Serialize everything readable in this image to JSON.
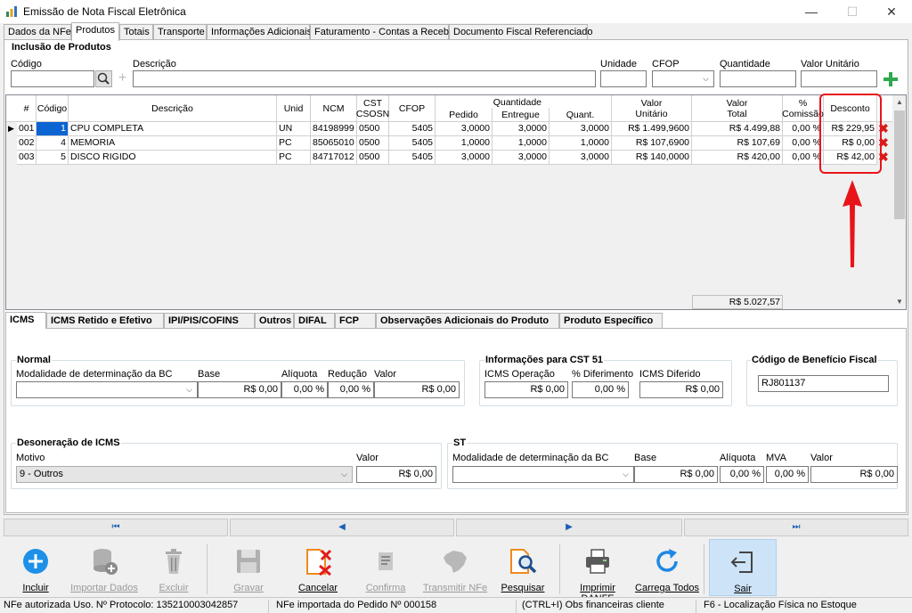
{
  "window": {
    "title": "Emissão de Nota Fiscal Eletrônica",
    "minimize": "—",
    "maximize": "☐",
    "close": "✕"
  },
  "tabs": [
    "Dados da NFe",
    "Produtos",
    "Totais",
    "Transporte",
    "Informações Adicionais",
    "Faturamento - Contas a Receber",
    "Documento Fiscal Referenciado"
  ],
  "inclusao": {
    "title": "Inclusão de Produtos",
    "labels": {
      "codigo": "Código",
      "descricao": "Descrição",
      "unidade": "Unidade",
      "cfop": "CFOP",
      "quantidade": "Quantidade",
      "valor_unitario": "Valor Unitário"
    },
    "values": {
      "codigo": "",
      "descricao": "",
      "unidade": "",
      "cfop": "",
      "quantidade": "",
      "valor_unitario": ""
    }
  },
  "grid": {
    "headers": {
      "num": "#",
      "codigo": "Código",
      "descricao": "Descrição",
      "unid": "Unid",
      "ncm": "NCM",
      "cst": "CST CSOSN",
      "cfop": "CFOP",
      "qtd_group": "Quantidade",
      "pedido": "Pedido",
      "entregue": "Entregue",
      "quant": "Quant.",
      "valor_unit": "Valor Unitário",
      "valor_total": "Valor Total",
      "comissao": "% Comissão",
      "desconto": "Desconto"
    },
    "rows": [
      {
        "num": "001",
        "codigo": "1",
        "descricao": "CPU COMPLETA",
        "unid": "UN",
        "ncm": "84198999",
        "cst": "0500",
        "cfop": "5405",
        "pedido": "3,0000",
        "entregue": "3,0000",
        "quant": "3,0000",
        "valor_unit": "R$ 1.499,9600",
        "valor_total": "R$ 4.499,88",
        "comissao": "0,00 %",
        "desconto": "R$ 229,95"
      },
      {
        "num": "002",
        "codigo": "4",
        "descricao": "MEMORIA",
        "unid": "PC",
        "ncm": "85065010",
        "cst": "0500",
        "cfop": "5405",
        "pedido": "1,0000",
        "entregue": "1,0000",
        "quant": "1,0000",
        "valor_unit": "R$ 107,6900",
        "valor_total": "R$ 107,69",
        "comissao": "0,00 %",
        "desconto": "R$ 0,00"
      },
      {
        "num": "003",
        "codigo": "5",
        "descricao": "DISCO RIGIDO",
        "unid": "PC",
        "ncm": "84717012",
        "cst": "0500",
        "cfop": "5405",
        "pedido": "3,0000",
        "entregue": "3,0000",
        "quant": "3,0000",
        "valor_unit": "R$ 140,0000",
        "valor_total": "R$ 420,00",
        "comissao": "0,00 %",
        "desconto": "R$ 42,00"
      }
    ],
    "total": "R$ 5.027,57",
    "highlight_color": "#e8141a"
  },
  "subtabs": [
    "ICMS",
    "ICMS Retido e Efetivo",
    "IPI/PIS/COFINS",
    "Outros",
    "DIFAL",
    "FCP",
    "Observações Adicionais do Produto",
    "Produto Específico"
  ],
  "normal": {
    "title": "Normal",
    "labels": {
      "modalidade": "Modalidade de determinação da BC",
      "base": "Base",
      "aliquota": "Alíquota",
      "reducao": "Redução",
      "valor": "Valor"
    },
    "values": {
      "modalidade": "",
      "base": "R$ 0,00",
      "aliquota": "0,00 %",
      "reducao": "0,00 %",
      "valor": "R$ 0,00"
    }
  },
  "cst51": {
    "title": "Informações para CST 51",
    "labels": {
      "operacao": "ICMS Operação",
      "diferimento": "% Diferimento",
      "diferido": "ICMS Diferido"
    },
    "values": {
      "operacao": "R$ 0,00",
      "diferimento": "0,00 %",
      "diferido": "R$ 0,00"
    }
  },
  "beneficio": {
    "title": "Código de Benefício Fiscal",
    "value": "RJ801137"
  },
  "desoneracao": {
    "title": "Desoneração de ICMS",
    "labels": {
      "motivo": "Motivo",
      "valor": "Valor"
    },
    "values": {
      "motivo": "9 - Outros",
      "valor": "R$ 0,00"
    }
  },
  "st": {
    "title": "ST",
    "labels": {
      "modalidade": "Modalidade de determinação da BC",
      "base": "Base",
      "aliquota": "Alíquota",
      "mva": "MVA",
      "valor": "Valor"
    },
    "values": {
      "modalidade": "",
      "base": "R$ 0,00",
      "aliquota": "0,00 %",
      "mva": "0,00 %",
      "valor": "R$ 0,00"
    }
  },
  "nav": {
    "first": "⏮",
    "prev": "◀",
    "next": "▶",
    "last": "⏭"
  },
  "toolbar": {
    "incluir": "Incluir",
    "importar": "Importar Dados",
    "excluir": "Excluir",
    "gravar": "Gravar",
    "cancelar": "Cancelar",
    "confirma": "Confirma",
    "transmitir": "Transmitir NFe",
    "pesquisar": "Pesquisar",
    "imprimir": "Imprimir DANFE",
    "carrega": "Carrega Todos",
    "sair": "Sair"
  },
  "status": [
    "NFe autorizada Uso. Nº Protocolo: 135210003042857",
    "NFe importada do Pedido Nº 000158",
    "(CTRL+I) Obs financeiras cliente",
    "F6 - Localização Física no Estoque"
  ]
}
